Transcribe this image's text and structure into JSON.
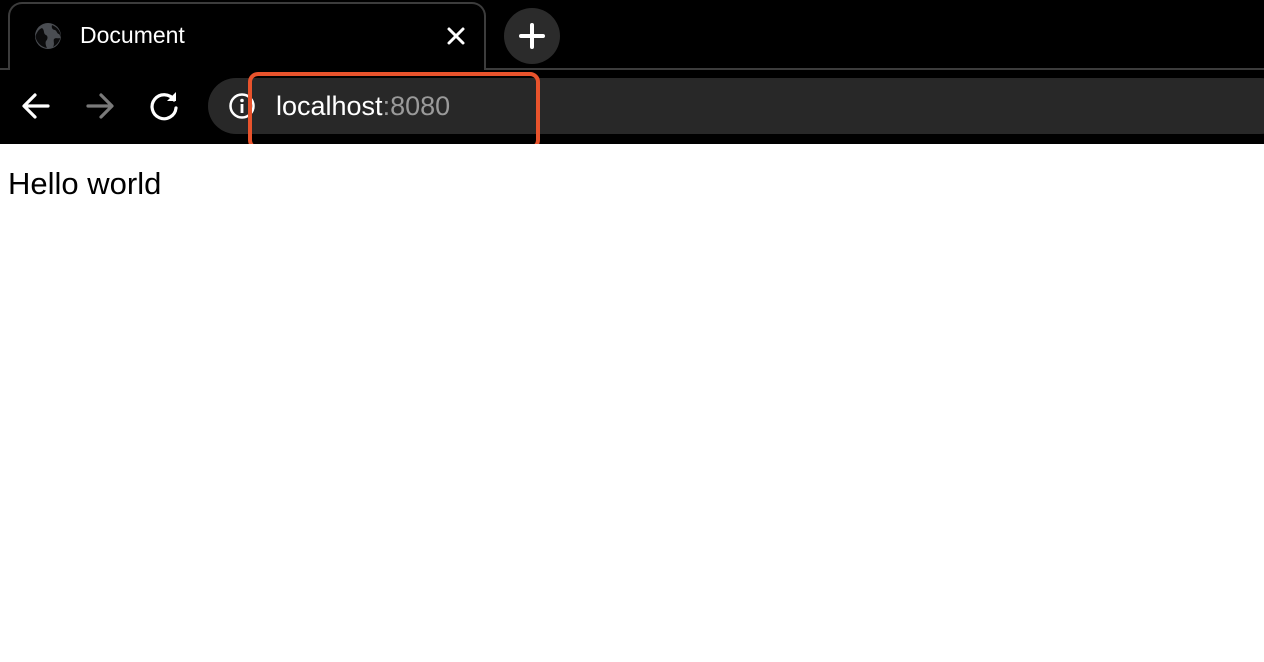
{
  "tab": {
    "title": "Document",
    "favicon_icon": "globe-icon",
    "close_icon": "close-icon"
  },
  "new_tab": {
    "icon": "plus-icon"
  },
  "toolbar": {
    "back_icon": "arrow-left-icon",
    "forward_icon": "arrow-right-icon",
    "forward_enabled": false,
    "reload_icon": "reload-icon"
  },
  "omnibox": {
    "info_icon": "info-icon",
    "host": "localhost",
    "port": ":8080"
  },
  "page": {
    "body_text": "Hello world"
  },
  "colors": {
    "chrome_background": "#000000",
    "omnibox_background": "#282828",
    "highlight": "#e8532c",
    "url_port": "#9a9a9a",
    "page_background": "#ffffff"
  }
}
